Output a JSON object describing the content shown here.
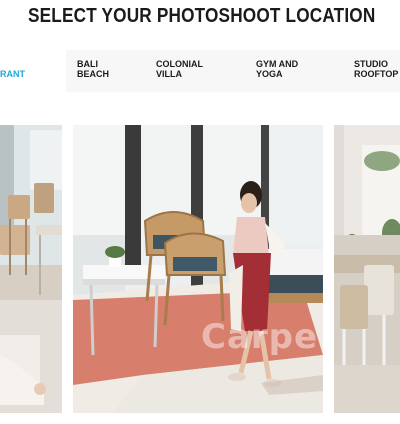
{
  "page": {
    "title": "SELECT YOUR PHOTOSHOOT LOCATION"
  },
  "tabs": [
    {
      "label": "RANT",
      "active": true
    },
    {
      "label": "BALI\nBEACH",
      "active": false
    },
    {
      "label": "COLONIAL\nVILLA",
      "active": false
    },
    {
      "label": "GYM AND\nYOGA",
      "active": false
    },
    {
      "label": "STUDIO\nROOFTOP",
      "active": false
    }
  ],
  "gallery": {
    "watermark": "Carpe"
  },
  "colors": {
    "accent": "#21a6d8",
    "tab_bar_background": "#f7f7f7",
    "title_text": "#1b1b1b"
  }
}
